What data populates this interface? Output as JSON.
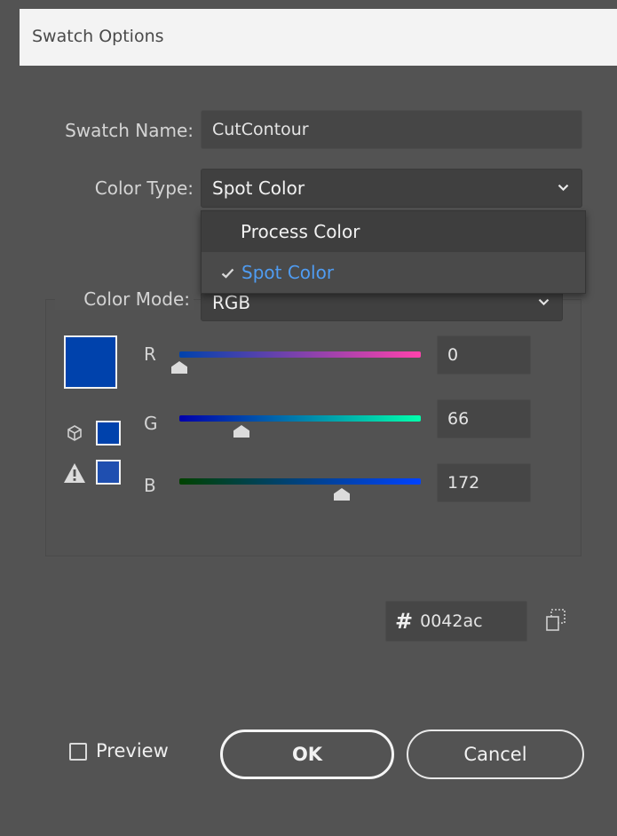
{
  "dialog": {
    "title": "Swatch Options"
  },
  "swatch_name": {
    "label": "Swatch Name:",
    "value": "CutContour"
  },
  "color_type": {
    "label": "Color Type:",
    "selected": "Spot Color",
    "options": [
      {
        "label": "Process Color",
        "checked": false
      },
      {
        "label": "Spot Color",
        "checked": true
      }
    ]
  },
  "color_mode": {
    "label": "Color Mode:",
    "selected": "RGB"
  },
  "channels": {
    "r": {
      "label": "R",
      "value": "0",
      "level": 0
    },
    "g": {
      "label": "G",
      "value": "66",
      "level": 66
    },
    "b": {
      "label": "B",
      "value": "172",
      "level": 172
    }
  },
  "hex": {
    "symbol": "#",
    "value": "0042ac"
  },
  "preview": {
    "label": "Preview",
    "checked": false
  },
  "buttons": {
    "ok": "OK",
    "cancel": "Cancel"
  },
  "colors": {
    "swatch": "#0042ac",
    "accent_menu_text": "#4f9cf2",
    "r_track_start": "#0042ac",
    "r_track_end": "#ff42ac",
    "g_track_start": "#0000ac",
    "g_track_end": "#00ffac",
    "b_track_start": "#004200",
    "b_track_end": "#0042ff"
  },
  "icons": {
    "out_of_web": "cube-icon",
    "out_of_gamut": "warning-icon",
    "copy": "copy-icon",
    "dropdown": "chevron-down-icon",
    "check": "check-icon"
  }
}
